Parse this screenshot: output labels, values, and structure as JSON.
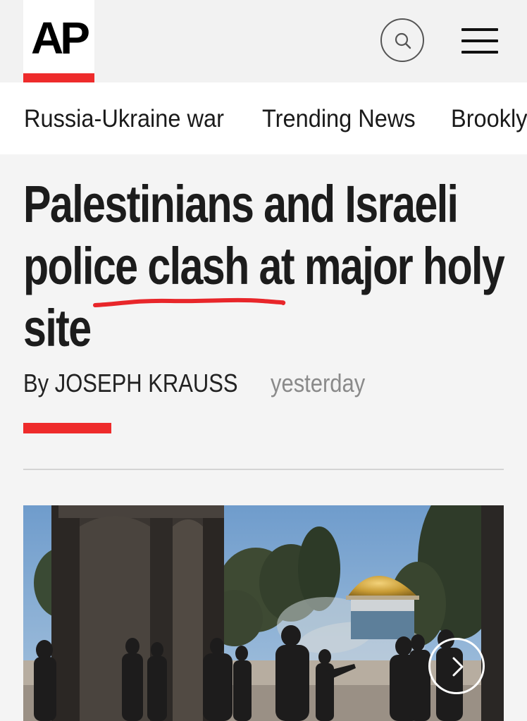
{
  "header": {
    "logo_text": "AP",
    "logo_accent_color": "#ee2b2b",
    "search_icon": "search-icon",
    "menu_icon": "hamburger-menu-icon"
  },
  "nav": {
    "items": [
      {
        "label": "Russia-Ukraine war"
      },
      {
        "label": "Trending News"
      },
      {
        "label": "Brookly"
      }
    ]
  },
  "article": {
    "headline_lines": [
      "Palestinians and Israeli",
      "police clash at major holy",
      "site"
    ],
    "byline": "By JOSEPH KRAUSS",
    "timestamp": "yesterday",
    "accent_color": "#ee2b2b"
  },
  "photo": {
    "next_icon": "chevron-right-icon"
  }
}
